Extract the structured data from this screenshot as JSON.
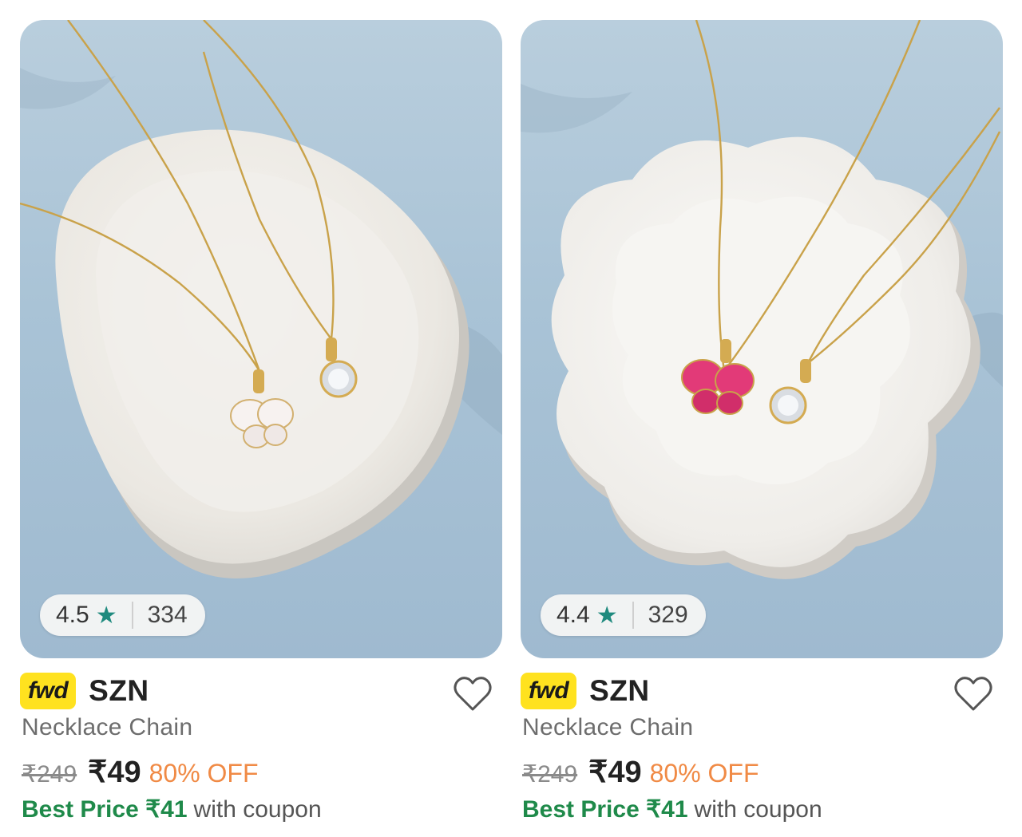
{
  "products": [
    {
      "rating": "4.5",
      "rating_count": "334",
      "badge": "fwd",
      "brand": "SZN",
      "name": "Necklace Chain",
      "mrp": "₹249",
      "price": "₹49",
      "discount": "80% OFF",
      "best_price": "Best Price ₹41",
      "best_suffix": "with coupon",
      "pendant_color": "#f7f2f0"
    },
    {
      "rating": "4.4",
      "rating_count": "329",
      "badge": "fwd",
      "brand": "SZN",
      "name": "Necklace Chain",
      "mrp": "₹249",
      "price": "₹49",
      "discount": "80% OFF",
      "best_price": "Best Price ₹41",
      "best_suffix": "with coupon",
      "pendant_color": "#e23a78"
    }
  ],
  "icons": {
    "star": "star-icon",
    "wishlist": "heart-outline-icon"
  },
  "colors": {
    "rating_star": "#1f8a7e",
    "fwd_badge": "#ffe21f",
    "discount": "#f08a45",
    "best_price": "#1f8a4a"
  }
}
